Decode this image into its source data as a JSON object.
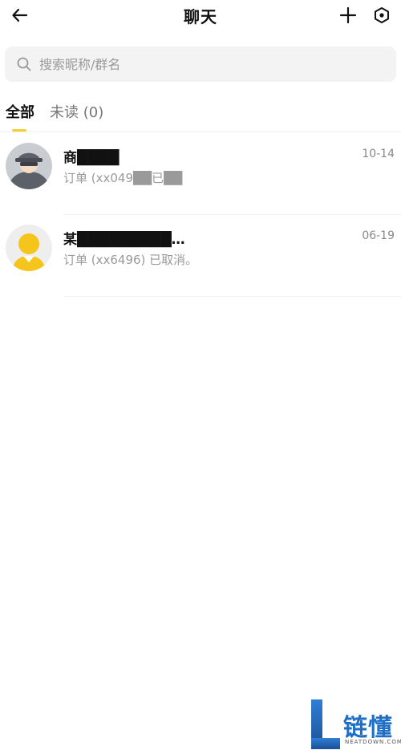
{
  "header": {
    "title": "聊天",
    "back_icon": "arrow-left-icon",
    "plus_icon": "plus-icon",
    "settings_icon": "hexagon-settings-icon"
  },
  "search": {
    "placeholder": "搜索昵称/群名",
    "value": ""
  },
  "tabs": [
    {
      "label": "全部",
      "active": true
    },
    {
      "label": "未读 (0)",
      "active": false
    }
  ],
  "colors": {
    "accent": "#f5cf30",
    "search_bg": "#f3f3f3",
    "secondary_text": "#9a9a9a"
  },
  "chats": [
    {
      "name": "商████",
      "preview": "订单 (xx049██已██",
      "time": "10-14",
      "avatar_icon": "masked-person-avatar-icon"
    },
    {
      "name": "某█████████…",
      "preview": "订单 (xx6496) 已取消。",
      "time": "06-19",
      "avatar_icon": "yellow-person-avatar-icon"
    }
  ],
  "watermark": {
    "text": "链懂",
    "sub": "NEATDOWN.COM"
  }
}
